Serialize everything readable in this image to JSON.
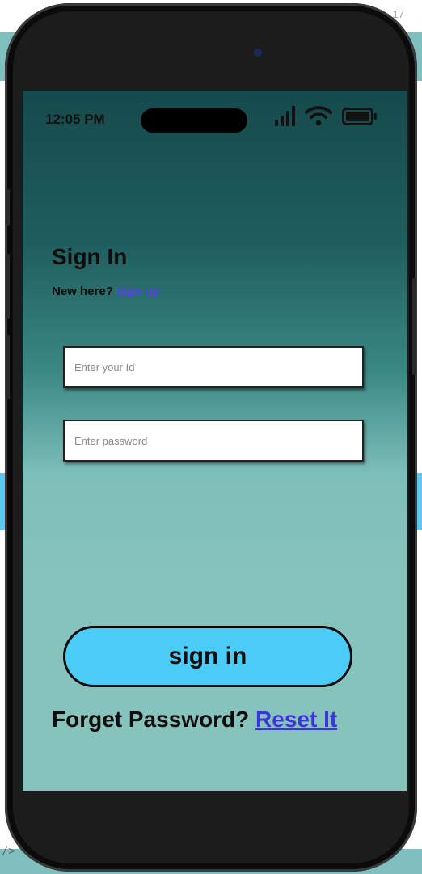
{
  "status_bar": {
    "time": "12:05 PM",
    "icons": [
      "signal-icon",
      "wifi-icon",
      "battery-icon"
    ]
  },
  "background": {
    "corner_number": "17",
    "corner_code": "/>"
  },
  "signin": {
    "title": "Sign In",
    "new_here": "New here?",
    "signup_link": "sign up",
    "id_placeholder": "Enter your Id",
    "id_value": "",
    "password_placeholder": "Enter password",
    "password_value": "",
    "signin_button": "sign in",
    "forgot_text": "Forget Password?",
    "reset_link": "Reset It"
  },
  "colors": {
    "accent_button": "#4accf7",
    "link": "#5a3df0",
    "screen_top": "#164a4c",
    "screen_bottom": "#87c3bd"
  }
}
